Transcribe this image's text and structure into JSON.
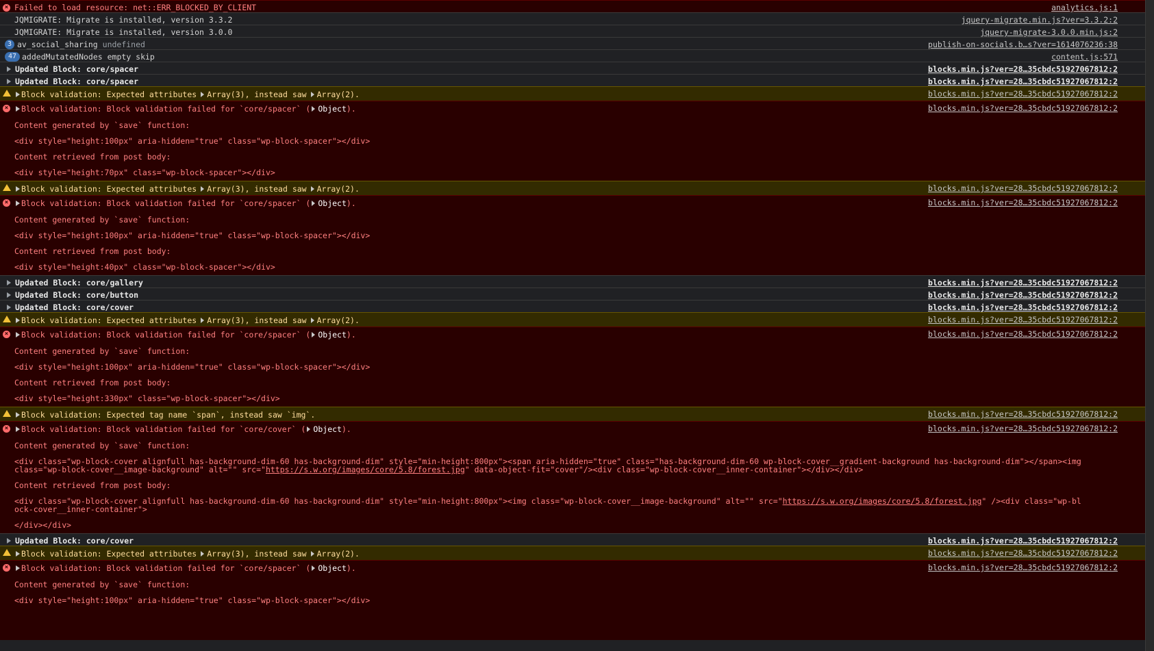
{
  "rows": [
    {
      "type": "error",
      "icon": "error",
      "text": "Failed to load resource: net::ERR_BLOCKED_BY_CLIENT",
      "source": "analytics.js:1"
    },
    {
      "type": "log",
      "text": "JQMIGRATE: Migrate is installed, version 3.3.2",
      "source": "jquery-migrate.min.js?ver=3.3.2:2"
    },
    {
      "type": "log",
      "text": "JQMIGRATE: Migrate is installed, version 3.0.0",
      "source": "jquery-migrate-3.0.0.min.js:2"
    },
    {
      "type": "log",
      "badge": "3",
      "text": "av_social_sharing",
      "text_light": "undefined",
      "source": "publish-on-socials.b…s?ver=1614076236:38"
    },
    {
      "type": "log",
      "badge": "47",
      "text": "addedMutatedNodes empty skip",
      "source": "content.js:571"
    },
    {
      "type": "group",
      "text": "Updated Block: core/spacer",
      "source": "blocks.min.js?ver=28…35cbdc51927067812:2"
    },
    {
      "type": "group",
      "text": "Updated Block: core/spacer",
      "source": "blocks.min.js?ver=28…35cbdc51927067812:2"
    }
  ],
  "warn_attr": {
    "prefix": "Block validation: Expected attributes",
    "mid": ", instead saw",
    "a1": "Array(3)",
    "a2": "Array(2)",
    "suffix": "."
  },
  "err_spacer": {
    "prefix": "Block validation: Block validation failed for `core/spacer` (",
    "obj": "Object",
    "suffix": ")."
  },
  "err_cover": {
    "prefix": "Block validation: Block validation failed for `core/cover` (",
    "obj": "Object",
    "suffix": ")."
  },
  "warn_tag": "Block validation: Expected tag name `span`, instead saw `img`.",
  "labels": {
    "generated": "Content generated by `save` function:",
    "retrieved": "Content retrieved from post body:",
    "save_spacer": "<div style=\"height:100px\" aria-hidden=\"true\" class=\"wp-block-spacer\"></div>",
    "post_70": "<div style=\"height:70px\" class=\"wp-block-spacer\"></div>",
    "post_40": "<div style=\"height:40px\" class=\"wp-block-spacer\"></div>",
    "post_330": "<div style=\"height:330px\" class=\"wp-block-spacer\"></div>",
    "cover_save_1": "<div class=\"wp-block-cover alignfull has-background-dim-60 has-background-dim\" style=\"min-height:800px\"><span aria-hidden=\"true\" class=\"has-background-dim-60 wp-block-cover__gradient-background has-background-dim\"></span><img class=\"wp-block-cover__image-background\" alt=\"\" src=\"",
    "cover_url": "https://s.w.org/images/core/5.8/forest.jpg",
    "cover_save_2": "\" data-object-fit=\"cover\"/><div class=\"wp-block-cover__inner-container\"></div></div>",
    "cover_post_1": "<div class=\"wp-block-cover alignfull has-background-dim-60 has-background-dim\" style=\"min-height:800px\"><img class=\"wp-block-cover__image-background\" alt=\"\" src=\"",
    "cover_post_2": "\" /><div class=\"wp-block-cover__inner-container\">",
    "cover_post_3": "</div></div>"
  },
  "groups": {
    "gallery": "Updated Block: core/gallery",
    "button": "Updated Block: core/button",
    "cover": "Updated Block: core/cover"
  },
  "block_source": "blocks.min.js?ver=28…35cbdc51927067812:2"
}
